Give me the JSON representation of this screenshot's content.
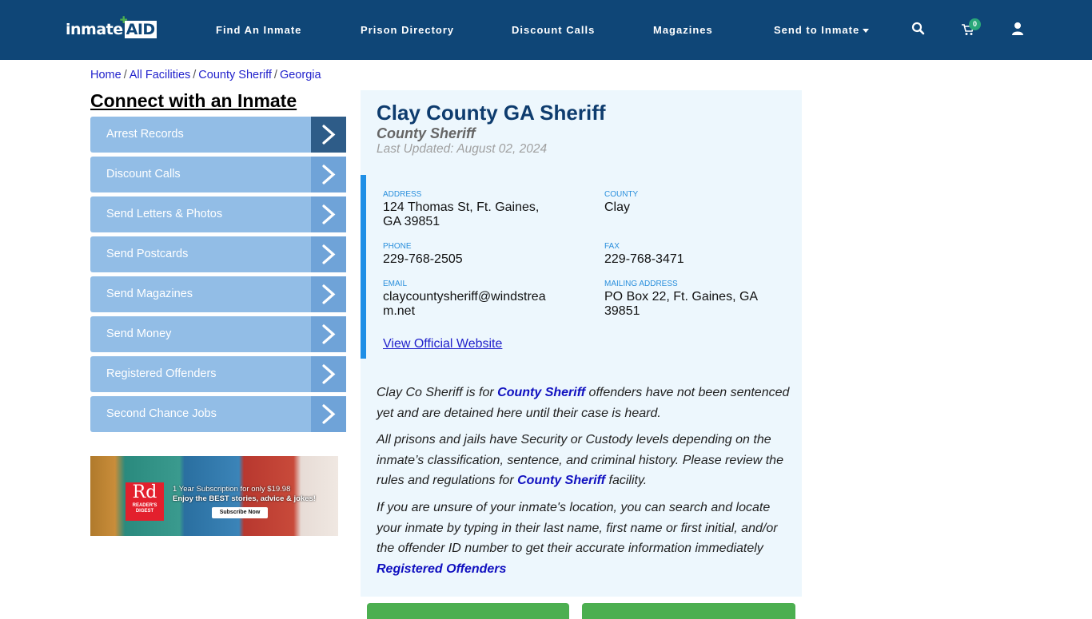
{
  "header": {
    "logo_text": "inmate",
    "logo_accent": "AID",
    "nav": [
      {
        "label": "Find An Inmate"
      },
      {
        "label": "Prison Directory"
      },
      {
        "label": "Discount Calls"
      },
      {
        "label": "Magazines"
      },
      {
        "label": "Send to Inmate"
      }
    ],
    "cart_count": "0",
    "icons": [
      "search-icon",
      "cart-icon",
      "user-icon"
    ]
  },
  "breadcrumb": [
    {
      "label": "Home"
    },
    {
      "label": "All Facilities"
    },
    {
      "label": "County Sheriff"
    },
    {
      "label": "Georgia"
    }
  ],
  "breadcrumb_sep": "/",
  "sidebar": {
    "title": "Connect with an Inmate",
    "items": [
      {
        "label": "Arrest Records"
      },
      {
        "label": "Discount Calls"
      },
      {
        "label": "Send Letters & Photos"
      },
      {
        "label": "Send Postcards"
      },
      {
        "label": "Send Magazines"
      },
      {
        "label": "Send Money"
      },
      {
        "label": "Registered Offenders"
      },
      {
        "label": "Second Chance Jobs"
      }
    ]
  },
  "ad": {
    "logo_text": "Rd",
    "logo_name": "READER'S DIGEST",
    "line1": "1 Year Subscription for only $19.98",
    "line2": "Enjoy the BEST stories, advice & jokes!",
    "button": "Subscribe Now"
  },
  "facility": {
    "title": "Clay County GA Sheriff",
    "type": "County Sheriff",
    "updated": "Last Updated: August 02, 2024",
    "fields": {
      "address": {
        "label": "ADDRESS",
        "value": "124 Thomas St, Ft. Gaines, GA 39851"
      },
      "county": {
        "label": "COUNTY",
        "value": "Clay"
      },
      "phone": {
        "label": "PHONE",
        "value": "229-768-2505"
      },
      "fax": {
        "label": "FAX",
        "value": "229-768-3471"
      },
      "email": {
        "label": "EMAIL",
        "value": "claycountysheriff@windstream.net"
      },
      "mailing": {
        "label": "MAILING ADDRESS",
        "value": "PO Box 22, Ft. Gaines, GA 39851"
      }
    },
    "website_link": "View Official Website"
  },
  "description": {
    "p1_a": "Clay Co Sheriff is for ",
    "p1_link": "County Sheriff",
    "p1_b": " offenders have not been sentenced yet and are detained here until their case is heard.",
    "p2_a": "All prisons and jails have Security or Custody levels depending on the inmate’s classification, sentence, and criminal history. Please review the rules and regulations for ",
    "p2_link": "County Sheriff",
    "p2_b": " facility.",
    "p3": "If you are unsure of your inmate's location, you can search and locate your inmate by typing in their last name, first name or first initial, and/or the offender ID number to get their accurate information immediately",
    "p3_link": "Registered Offenders"
  },
  "colors": {
    "header_bg": "#0f4677",
    "panel_bg": "#edf7fd",
    "accent_blue": "#1f8fe6",
    "sidebar_item": "#92bde6",
    "green_button": "#4caf50"
  }
}
